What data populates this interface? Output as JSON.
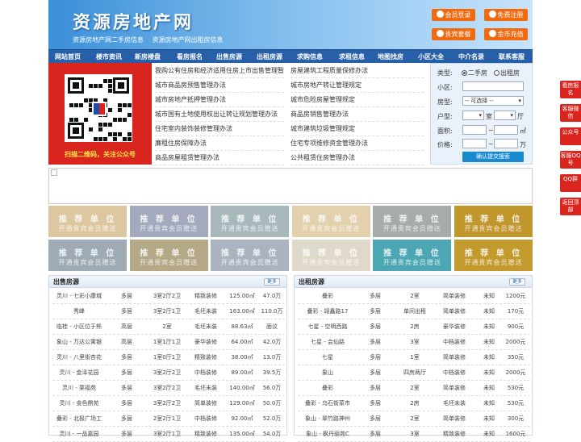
{
  "header": {
    "logo": "资源房地产网",
    "tagline": [
      "资源房地产网二手房信息",
      "资源房地产网出租房信息"
    ],
    "buttons": [
      "会员登录",
      "免费注册",
      "贵宾套餐",
      "金币充值"
    ]
  },
  "nav": [
    "网站首页",
    "楼市资讯",
    "新房楼盘",
    "看房报名",
    "出售房源",
    "出租房源",
    "求购信息",
    "求租信息",
    "地图找房",
    "小区大全",
    "中介名录",
    "联系客服"
  ],
  "qr": {
    "caption": "扫描二维码，关注公众号"
  },
  "links": {
    "left": [
      "我购公有住房和经济适用住房上市出售管理暂",
      "城市商品房预售管理办法",
      "城市房地产抵押管理办法",
      "城市国有土地使用权出让转让规划管理办法",
      "住宅室内装饰装修管理办法",
      "廉租住房保障办法",
      "商品房屋租赁管理办法"
    ],
    "right": [
      "房屋建筑工程质量保修办法",
      "城市房地产转让管理规定",
      "城市危险房屋管理规定",
      "商品房销售管理办法",
      "城市建筑垃圾管理规定",
      "住宅专项维修资金管理办法",
      "公共租赁住房管理办法"
    ]
  },
  "search": {
    "type_label": "类型:",
    "type_options": [
      "二手房",
      "出租房"
    ],
    "community_label": "小区:",
    "community_value": "",
    "house_type_label": "房型:",
    "house_type_value": "-- 可选择 --",
    "layout_label": "户型:",
    "room_unit": "室",
    "hall_unit": "厅",
    "area_label": "面积:",
    "area_from": "",
    "area_to": "",
    "area_unit": "㎡",
    "price_label": "价格:",
    "price_from": "",
    "price_to": "",
    "price_unit": "万",
    "submit": "确认提交搜索"
  },
  "tiles": {
    "line1": "推 荐 单 位",
    "line2": "开通贵宾会员赠送",
    "colors": [
      "#dcc7a0",
      "#a3aabd",
      "#a9b9bb",
      "#e3d0ac",
      "#a7aba9",
      "#c0962d",
      "#9eabb5",
      "#b4a886",
      "#aab4c0",
      "#dfd9cc",
      "#4ca6b4",
      "#c39a2e"
    ]
  },
  "sell": {
    "title": "出售房源",
    "more": "更多",
    "rows": [
      [
        "灵川 - 七彩小康城",
        "多层",
        "3室2厅2卫",
        "精致装修",
        "125.00㎡",
        "47.0万"
      ],
      [
        "秀峰",
        "多层",
        "3室2厅1卫",
        "毛坯未装",
        "163.00㎡",
        "110.0万"
      ],
      [
        "临桂 - 小区位于熊",
        "高层",
        "2室",
        "毛坯未装",
        "88.63㎡",
        "面议"
      ],
      [
        "象山 - 万达公寓银",
        "高层",
        "1室1厅1卫",
        "豪华装修",
        "64.00㎡",
        "42.0万"
      ],
      [
        "灵川 - 八里街杏花",
        "多层",
        "1室0厅1卫",
        "精致装修",
        "38.00㎡",
        "13.0万"
      ],
      [
        "灵川 - 金泽花园",
        "多层",
        "3室2厅2卫",
        "中档装修",
        "89.00㎡",
        "39.5万"
      ],
      [
        "灵川 - 栗福苑",
        "多层",
        "3室2厅2卫",
        "毛坯未装",
        "140.00㎡",
        "56.0万"
      ],
      [
        "灵川 - 金色鼎苑",
        "多层",
        "3室2厅2卫",
        "简单装修",
        "129.00㎡",
        "50.0万"
      ],
      [
        "叠彩 - 北极广场工",
        "多层",
        "2室2厅1卫",
        "中档装修",
        "92.00㎡",
        "52.0万"
      ],
      [
        "灵川 - 一品嘉园",
        "多层",
        "3室2厅1卫",
        "精致装修",
        "135.00㎡",
        "54.0万"
      ]
    ]
  },
  "rent": {
    "title": "出租房源",
    "more": "更多",
    "rows": [
      [
        "叠彩",
        "多层",
        "2室",
        "简单装修",
        "未知",
        "1200元"
      ],
      [
        "叠彩 - 翊鑫路17",
        "多层",
        "单间出租",
        "简单装修",
        "未知",
        "170元"
      ],
      [
        "七星 - 空明西路",
        "多层",
        "2房",
        "豪华装修",
        "未知",
        "900元"
      ],
      [
        "七星 - 会仙路",
        "多层",
        "3室",
        "中档装修",
        "未知",
        "2000元"
      ],
      [
        "七星",
        "多层",
        "1室",
        "简单装修",
        "未知",
        "350元"
      ],
      [
        "象山",
        "多层",
        "四房两厅",
        "中档装修",
        "未知",
        "2000元"
      ],
      [
        "叠彩",
        "多层",
        "2室",
        "简单装修",
        "未知",
        "530元"
      ],
      [
        "叠彩 - 乌石街菜市",
        "多层",
        "2房",
        "毛坯未装",
        "未知",
        "530元"
      ],
      [
        "象山 - 翠竹路神州",
        "多层",
        "2室",
        "简单装修",
        "未知",
        "300元"
      ],
      [
        "象山 - 枫丹丽苑C",
        "多层",
        "3室",
        "精致装修",
        "未知",
        "1600元"
      ]
    ]
  },
  "side": [
    "看房报名",
    "客服微信",
    "公众号",
    "客服QQ号",
    "QQ群",
    "返回顶部"
  ]
}
